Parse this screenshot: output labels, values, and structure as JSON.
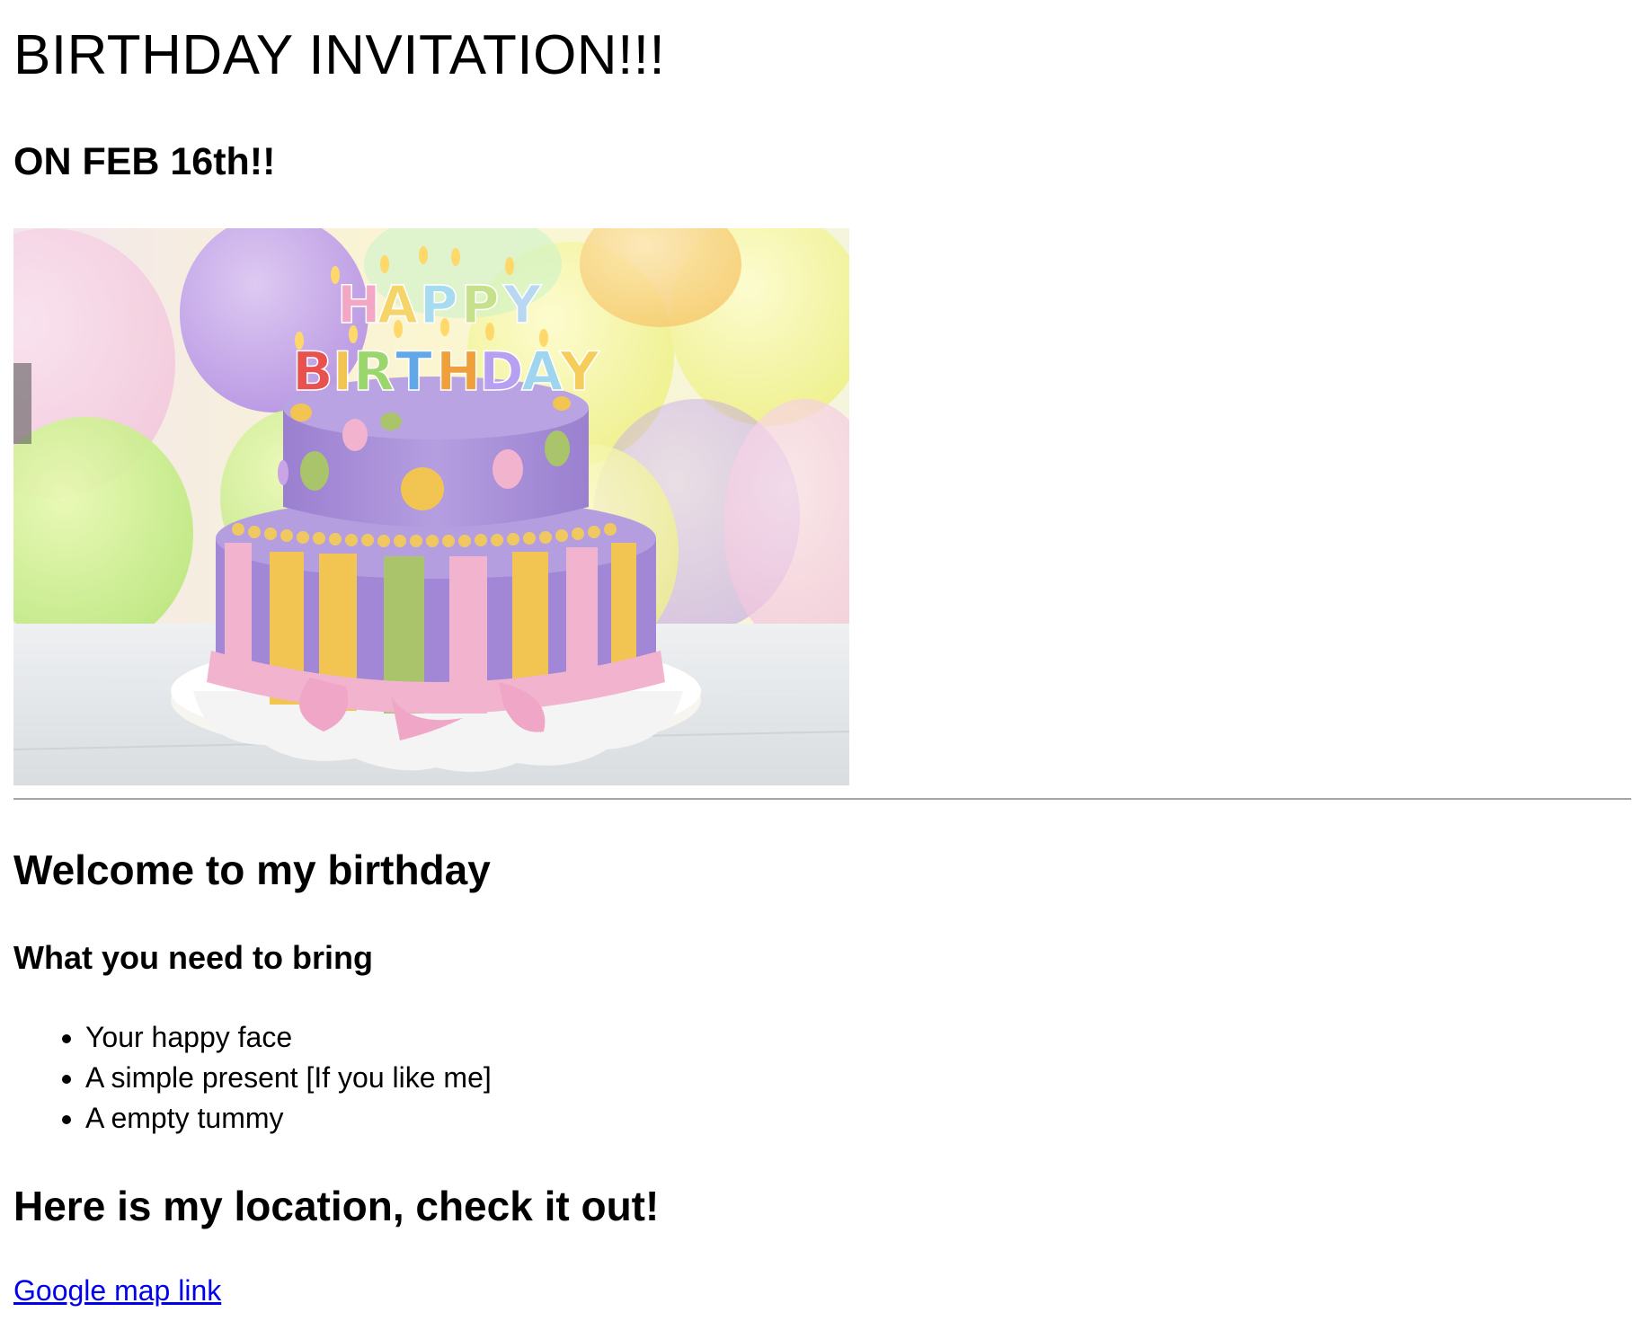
{
  "page": {
    "title": "BIRTHDAY INVITATION!!!",
    "date": "ON FEB 16th!!",
    "image": {
      "description_icon": "birthday-cake-photo",
      "cake_letters_top": "HAPPY",
      "cake_letters_bottom": "BIRTHDAY"
    },
    "welcome_heading": "Welcome to my birthday",
    "bring_heading": "What you need to bring",
    "bring_items": [
      "Your happy face",
      "A simple present [If you like me]",
      "A empty tummy"
    ],
    "location_heading": "Here is my location, check it out!",
    "map_link_label": "Google map link"
  },
  "colors": {
    "link": "#0000ee",
    "divider": "#a5a5a5",
    "cake_purple": "#a98fd6",
    "cake_yellow": "#f2c552",
    "cake_green": "#a9c46a",
    "cake_pink": "#f2b3cf"
  }
}
